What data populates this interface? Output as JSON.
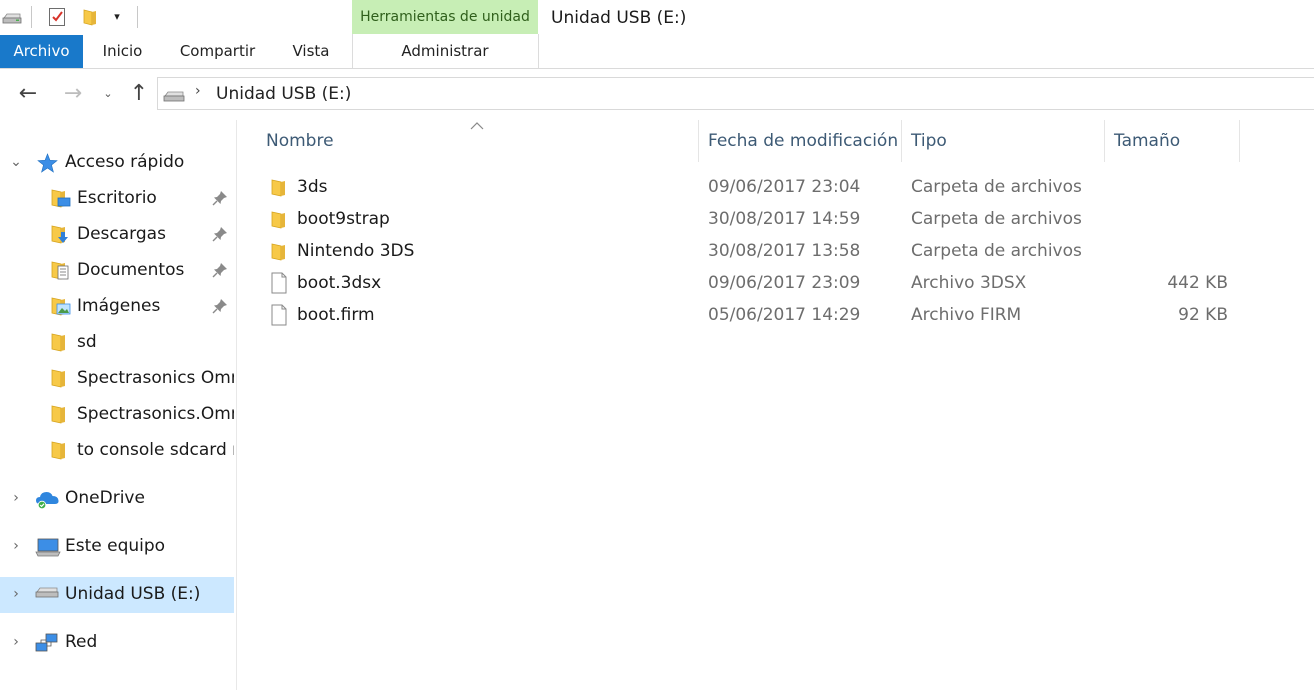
{
  "quick_access_toolbar": {
    "customize_glyph": "▾"
  },
  "ribbon": {
    "context_tab_group": "Herramientas de unidad",
    "tabs": [
      {
        "label": "Archivo"
      },
      {
        "label": "Inicio"
      },
      {
        "label": "Compartir"
      },
      {
        "label": "Vista"
      },
      {
        "label": "Administrar"
      }
    ]
  },
  "window": {
    "title": "Unidad USB (E:)"
  },
  "navigation": {
    "back_glyph": "←",
    "forward_glyph": "→",
    "recent_glyph": "⌄",
    "up_glyph": "↑",
    "address_separator": "›",
    "address_path": "Unidad USB (E:)"
  },
  "nav_pane": {
    "expander_expanded": "⌄",
    "expander_collapsed": "›",
    "quick_access": {
      "label": "Acceso rápido",
      "items": [
        {
          "label": "Escritorio",
          "pinned": true,
          "icon": "desktop-folder-icon"
        },
        {
          "label": "Descargas",
          "pinned": true,
          "icon": "downloads-folder-icon"
        },
        {
          "label": "Documentos",
          "pinned": true,
          "icon": "documents-folder-icon"
        },
        {
          "label": "Imágenes",
          "pinned": true,
          "icon": "pictures-folder-icon"
        },
        {
          "label": "sd",
          "pinned": false,
          "icon": "folder-icon"
        },
        {
          "label": "Spectrasonics Omni",
          "pinned": false,
          "icon": "folder-icon"
        },
        {
          "label": "Spectrasonics.Omni",
          "pinned": false,
          "icon": "folder-icon"
        },
        {
          "label": "to console sdcard ro",
          "pinned": false,
          "icon": "folder-icon"
        }
      ]
    },
    "roots": [
      {
        "label": "OneDrive",
        "icon": "onedrive-icon",
        "selected": false
      },
      {
        "label": "Este equipo",
        "icon": "this-pc-icon",
        "selected": false
      },
      {
        "label": "Unidad USB (E:)",
        "icon": "usb-drive-icon",
        "selected": true
      },
      {
        "label": "Red",
        "icon": "network-icon",
        "selected": false
      }
    ]
  },
  "file_list": {
    "columns": {
      "name": "Nombre",
      "date": "Fecha de modificación",
      "type": "Tipo",
      "size": "Tamaño"
    },
    "sort": {
      "column": "name",
      "direction": "ascending"
    },
    "rows": [
      {
        "name": "3ds",
        "date": "09/06/2017 23:04",
        "type": "Carpeta de archivos",
        "size": "",
        "kind": "folder"
      },
      {
        "name": "boot9strap",
        "date": "30/08/2017 14:59",
        "type": "Carpeta de archivos",
        "size": "",
        "kind": "folder"
      },
      {
        "name": "Nintendo 3DS",
        "date": "30/08/2017 13:58",
        "type": "Carpeta de archivos",
        "size": "",
        "kind": "folder"
      },
      {
        "name": "boot.3dsx",
        "date": "09/06/2017 23:09",
        "type": "Archivo 3DSX",
        "size": "442 KB",
        "kind": "file"
      },
      {
        "name": "boot.firm",
        "date": "05/06/2017 14:29",
        "type": "Archivo FIRM",
        "size": "92 KB",
        "kind": "file"
      }
    ]
  },
  "colors": {
    "archivo_tab": "#1979ca",
    "context_tab": "#c7eeb5",
    "selected_row": "#cce8ff",
    "folder": "#f7c948"
  }
}
